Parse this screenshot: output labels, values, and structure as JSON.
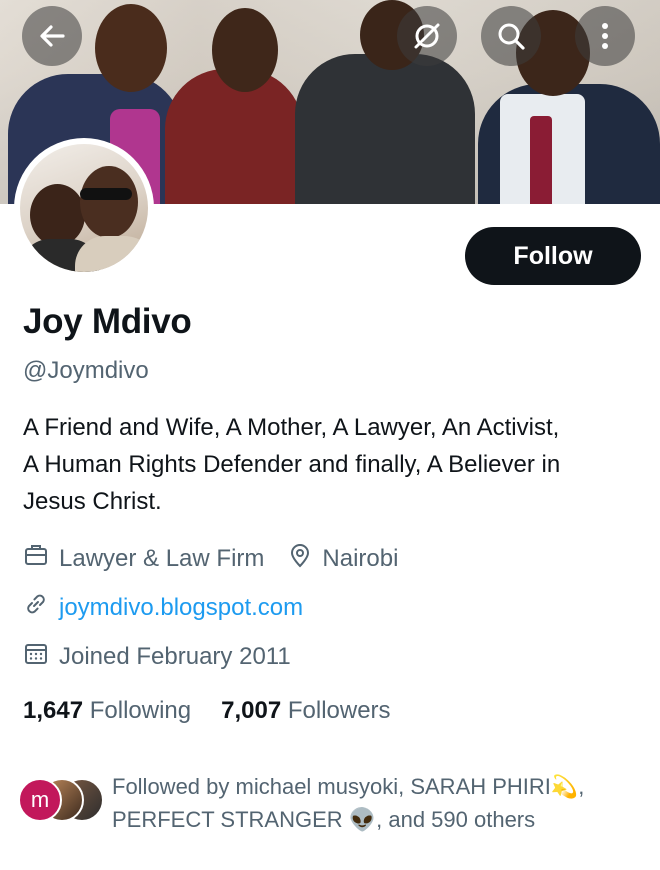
{
  "header": {
    "back_icon": "arrow-left-icon",
    "hide_icon": "eye-slash-icon",
    "search_icon": "search-icon",
    "more_icon": "more-vertical-icon"
  },
  "profile": {
    "name": "Joy Mdivo",
    "handle": "@Joymdivo",
    "follow_label": "Follow",
    "bio_line1": "A Friend and Wife, A Mother, A Lawyer, An Activist,",
    "bio_line2": "A Human Rights Defender and finally, A Believer in",
    "bio_line3": "Jesus Christ.",
    "category": "Lawyer & Law Firm",
    "location": "Nairobi",
    "website": "joymdivo.blogspot.com",
    "joined": "Joined February 2011",
    "following_count": "1,647",
    "following_label": "Following",
    "followers_count": "7,007",
    "followers_label": "Followers"
  },
  "followed_by": {
    "line1": "Followed by michael musyoki, SARAH PHIRI💫,",
    "line2": "PERFECT STRANGER 👽, and 590 others",
    "first_initial": "m"
  },
  "colors": {
    "accent": "#1d9bf0",
    "text": "#0f1419",
    "muted": "#536471",
    "button": "#0f1419"
  }
}
